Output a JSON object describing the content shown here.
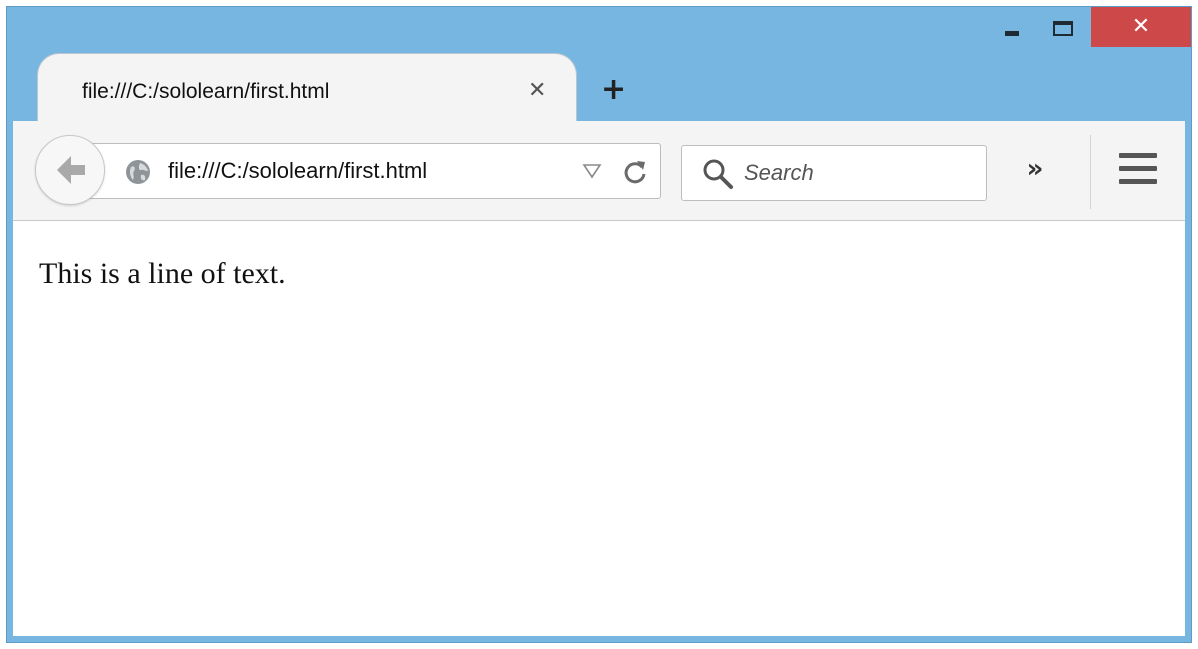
{
  "window": {
    "minimize_icon": "minimize-icon",
    "maximize_icon": "maximize-icon",
    "close_icon": "close-icon",
    "close_glyph": "✕",
    "close_color": "#cd4949",
    "frame_color": "#76b6e1"
  },
  "tab": {
    "title": "file:///C:/sololearn/first.html",
    "close_glyph": "✕",
    "new_tab_glyph": "+"
  },
  "toolbar": {
    "back_icon": "back-arrow-icon",
    "url": "file:///C:/sololearn/first.html",
    "globe_icon": "globe-icon",
    "dropmarker_icon": "dropmarker-icon",
    "reload_icon": "reload-icon",
    "search_placeholder": "Search",
    "search_icon": "search-icon",
    "overflow_glyph": "»",
    "menu_icon": "hamburger-menu-icon"
  },
  "page": {
    "text": "This is a line of text."
  }
}
